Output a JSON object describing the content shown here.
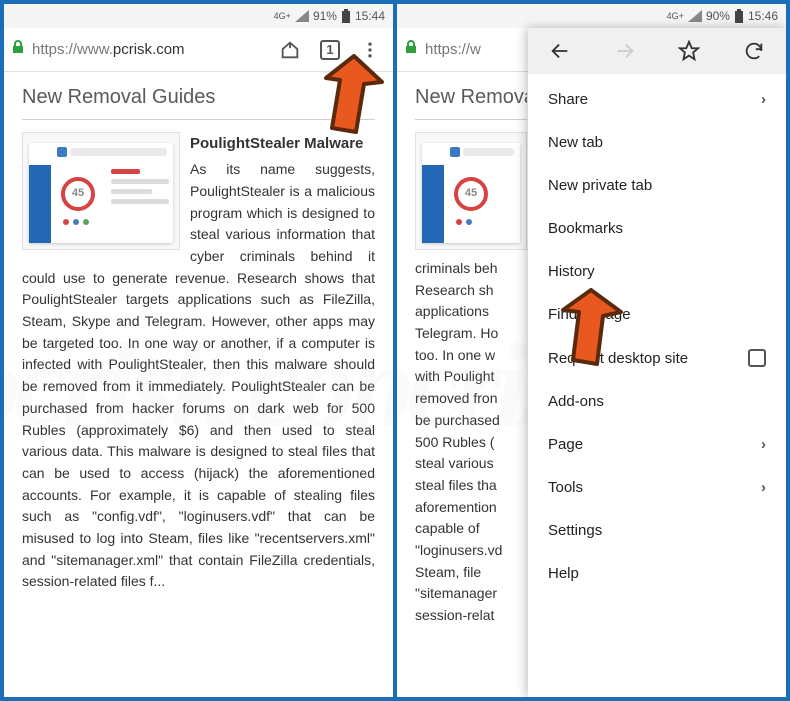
{
  "status_left": {
    "network": "4G+",
    "battery": "91%",
    "time": "15:44"
  },
  "status_right": {
    "network": "4G+",
    "battery": "90%",
    "time": "15:46"
  },
  "address": {
    "protocol": "https://",
    "prefix": "www.",
    "domain": "pcrisk.com",
    "truncated": "https://w"
  },
  "tab_count": "1",
  "section_title": "New Removal Guides",
  "section_title_trunc": "New Remo",
  "article": {
    "title": "PoulightStealer Malware",
    "body": "As its name suggests, PoulightStealer is a malicious program which is designed to steal various information that cyber criminals behind it could use to generate revenue. Research shows that PoulightStealer targets applications such as FileZilla, Steam, Skype and Telegram. However, other apps may be targeted too. In one way or another, if a computer is infected with PoulightStealer, then this malware should be removed from it immediately. PoulightStealer can be purchased from hacker forums on dark web for 500 Rubles (approximately $6) and then used to steal various data. This malware is designed to steal files that can be used to access (hijack) the aforementioned accounts. For example, it is capable of stealing files such as \"config.vdf\", \"loginusers.vdf\" that can be misused to log into Steam, files like \"recentservers.xml\" and \"sitemanager.xml\" that contain FileZilla credentials, session-related files f...",
    "body_trunc": "criminals behind it could use to generate revenue. Research shows that PoulightStealer targets applications such as FileZilla, Steam, Skype and Telegram. However, other apps may be targeted too. In one way or another, if a computer is infected with PoulightStealer, then this malware should be removed from it immediately. PoulightStealer can be purchased from hacker forums on dark web for 500 Rubles (approximately $6) and then used to steal various data. This malware is designed to steal files that can be used to access (hijack) the aforementioned accounts. For example, it is capable of stealing files such as \"config.vdf\", \"loginusers.vdf\" that can be misused to log into Steam, files like \"recentservers.xml\" and \"sitemanager.xml\" that contain FileZilla credentials, session-related files f..."
  },
  "thumb_number": "45",
  "menu": {
    "share": "Share",
    "new_tab": "New tab",
    "new_private": "New private tab",
    "bookmarks": "Bookmarks",
    "history": "History",
    "find": "Find in page",
    "request_desktop": "Request desktop site",
    "addons": "Add-ons",
    "page": "Page",
    "tools": "Tools",
    "settings": "Settings",
    "help": "Help"
  },
  "colors": {
    "frame": "#1a6fb8",
    "arrow": "#e8581f",
    "arrow_outline": "#5b2a0c"
  }
}
